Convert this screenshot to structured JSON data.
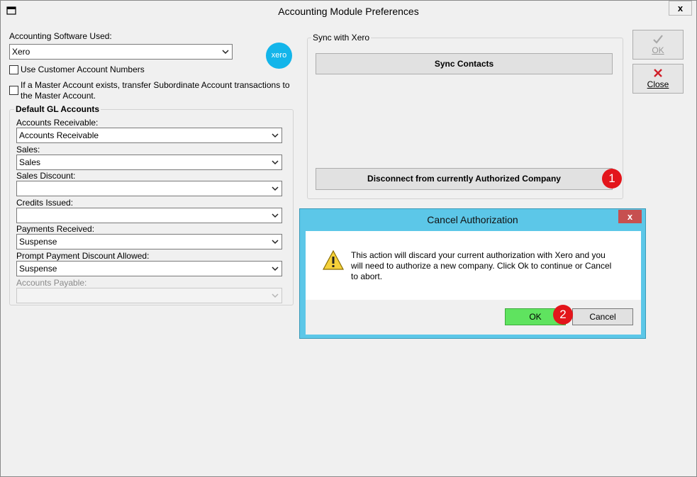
{
  "window": {
    "title": "Accounting Module Preferences",
    "close_label": "x"
  },
  "software": {
    "label": "Accounting Software Used:",
    "value": "Xero",
    "logo_text": "xero",
    "use_customer_numbers_label": "Use Customer Account Numbers",
    "master_account_label_line1": "If a Master Account exists, transfer Subordinate Account transactions to",
    "master_account_label_line2": "the Master Account."
  },
  "gl": {
    "title": "Default GL Accounts",
    "fields": [
      {
        "label": "Accounts Receivable:",
        "value": "Accounts Receivable"
      },
      {
        "label": "Sales:",
        "value": "Sales"
      },
      {
        "label": "Sales Discount:",
        "value": ""
      },
      {
        "label": "Credits Issued:",
        "value": ""
      },
      {
        "label": "Payments Received:",
        "value": "Suspense"
      },
      {
        "label": "Prompt Payment Discount Allowed:",
        "value": "Suspense"
      },
      {
        "label": "Accounts Payable:",
        "value": ""
      }
    ]
  },
  "sync": {
    "title": "Sync with Xero",
    "sync_contacts_label": "Sync Contacts",
    "disconnect_label": "Disconnect from currently Authorized Company"
  },
  "side_buttons": {
    "ok_label": "OK",
    "close_label": "Close"
  },
  "badges": {
    "one": "1",
    "two": "2"
  },
  "dialog": {
    "title": "Cancel Authorization",
    "close_label": "x",
    "message_line1": "This action will discard your current authorization with Xero and you",
    "message_line2": "will need to authorize a new company. Click Ok to continue or Cancel",
    "message_line3": "to abort.",
    "ok_label": "OK",
    "cancel_label": "Cancel"
  },
  "colors": {
    "xero_blue": "#13b5ea",
    "dialog_frame": "#5cc7e8",
    "ok_green": "#5fe35f",
    "badge_red": "#e3151b",
    "dialog_close_red": "#c75050"
  },
  "icons": [
    "window-icon",
    "dropdown-arrow-icon",
    "checkmark-icon",
    "x-close-icon",
    "warning-icon"
  ]
}
